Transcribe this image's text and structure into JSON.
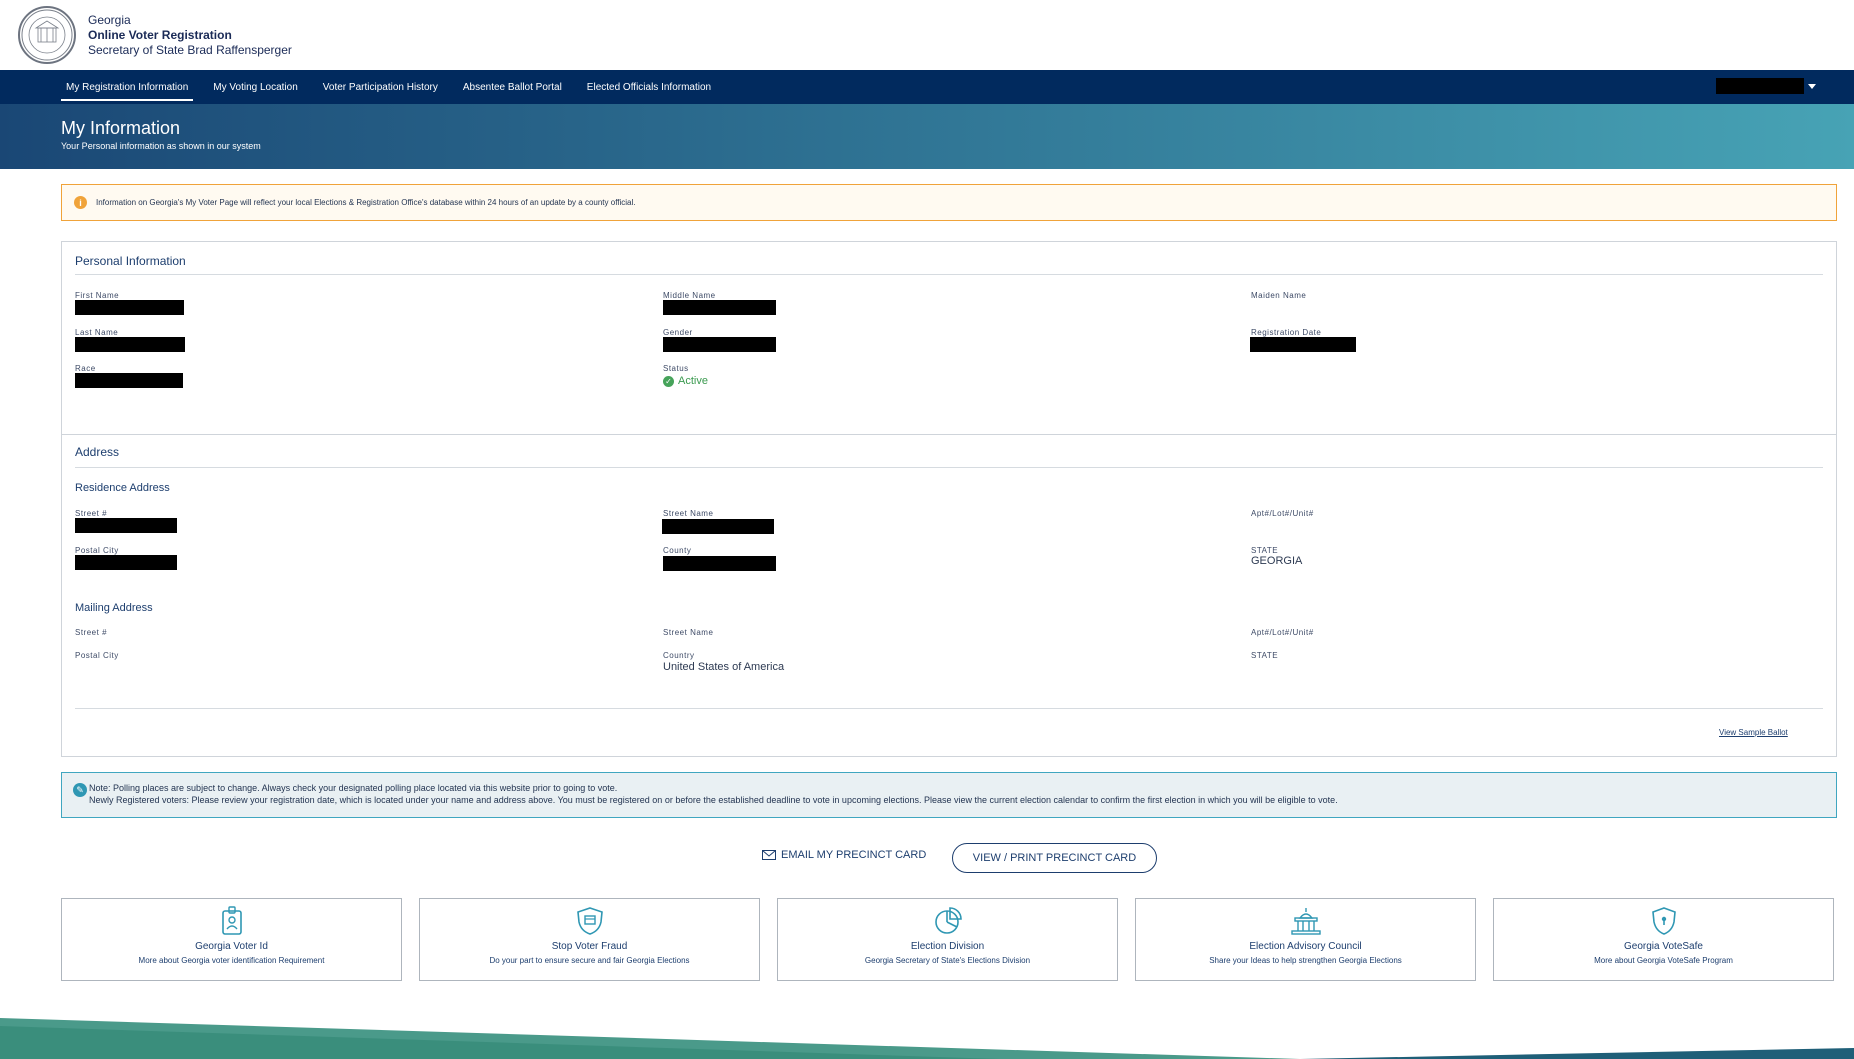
{
  "header": {
    "line1": "Georgia",
    "line2": "Online Voter Registration",
    "line3": "Secretary of State Brad Raffensperger"
  },
  "nav": {
    "items": [
      {
        "label": "My Registration Information"
      },
      {
        "label": "My Voting Location"
      },
      {
        "label": "Voter Participation History"
      },
      {
        "label": "Absentee Ballot Portal"
      },
      {
        "label": "Elected Officials Information"
      }
    ]
  },
  "hero": {
    "title": "My Information",
    "subtitle": "Your Personal information as shown in our system"
  },
  "alert": {
    "text": "Information on Georgia's My Voter Page will reflect your local Elections & Registration Office's database within 24 hours of an update by a county official."
  },
  "personal": {
    "title": "Personal Information",
    "first_name": "First Name",
    "middle_name": "Middle Name",
    "maiden_name": "Maiden Name",
    "last_name": "Last Name",
    "gender": "Gender",
    "registration_date": "Registration Date",
    "race": "Race",
    "status": "Status",
    "status_value": "Active"
  },
  "address": {
    "title": "Address",
    "residence_title": "Residence Address",
    "mailing_title": "Mailing Address",
    "street_no": "Street #",
    "street_name": "Street Name",
    "apt": "Apt#/Lot#/Unit#",
    "postal_city": "Postal City",
    "county": "County",
    "state": "STATE",
    "state_value": "GEORGIA",
    "country": "Country",
    "country_value": "United States of America",
    "sample_ballot": "View Sample Ballot"
  },
  "note": {
    "line1": "Note: Polling places are subject to change. Always check your designated polling place located via this website prior to going to vote.",
    "line2": "Newly Registered voters: Please review your registration date, which is located under your name and address above. You must be registered on or before the established deadline to vote in upcoming elections. Please view the current election calendar to confirm the first election in which you will be eligible to vote."
  },
  "precinct": {
    "email_label": "EMAIL MY PRECINCT CARD",
    "print_label": "VIEW / PRINT PRECINCT CARD"
  },
  "cards": [
    {
      "title": "Georgia Voter Id",
      "desc": "More about Georgia voter identification Requirement",
      "icon": "id-badge-icon"
    },
    {
      "title": "Stop Voter Fraud",
      "desc": "Do your part to ensure secure and fair Georgia Elections",
      "icon": "shield-badge-icon"
    },
    {
      "title": "Election Division",
      "desc": "Georgia Secretary of State's Elections Division",
      "icon": "pie-chart-icon"
    },
    {
      "title": "Election Advisory Council",
      "desc": "Share your Ideas to help strengthen Georgia Elections",
      "icon": "capitol-icon"
    },
    {
      "title": "Georgia VoteSafe",
      "desc": "More about Georgia VoteSafe Program",
      "icon": "shield-lock-icon"
    }
  ],
  "colors": {
    "nav_bg": "#012a5e",
    "alert_border": "#f0a33a",
    "accent": "#2f97b3",
    "status_green": "#46a35a"
  }
}
